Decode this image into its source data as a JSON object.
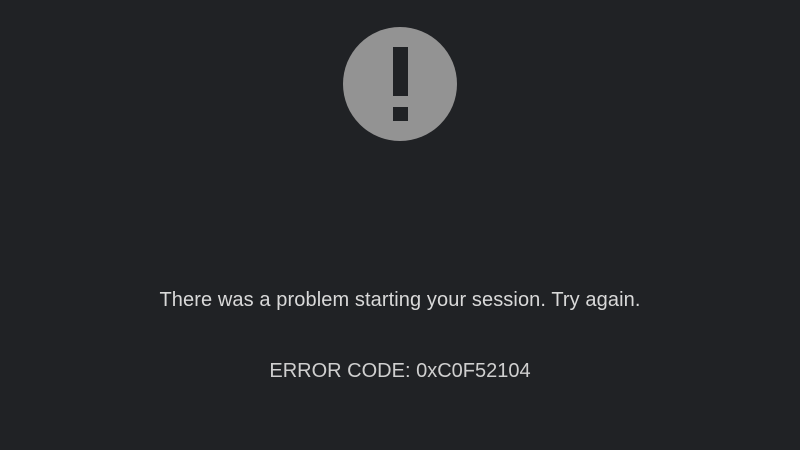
{
  "icon": "alert-icon",
  "colors": {
    "background": "#202225",
    "icon": "#939393",
    "text": "#d9d9d9"
  },
  "message": "There was a problem starting your session. Try again.",
  "error_code": "ERROR CODE: 0xC0F52104"
}
